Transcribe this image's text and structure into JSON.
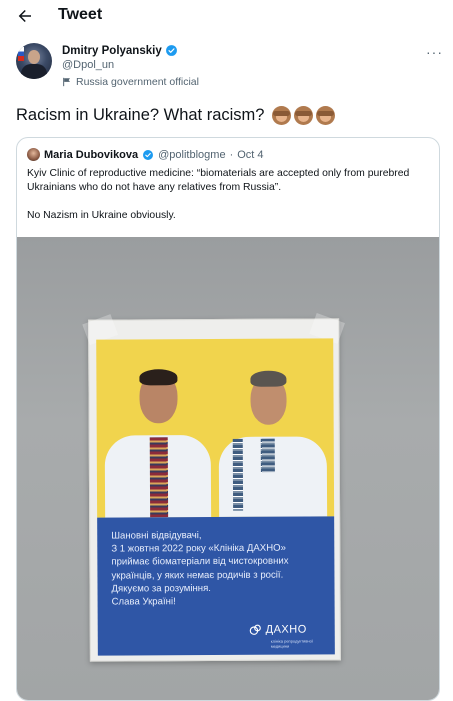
{
  "header": {
    "title": "Tweet"
  },
  "author": {
    "display_name": "Dmitry Polyanskiy",
    "handle": "@Dpol_un",
    "label": "Russia government official"
  },
  "tweet": {
    "text": "Racism in Ukraine? What racism?",
    "emoji": [
      "see-no-evil-monkey",
      "hear-no-evil-monkey",
      "speak-no-evil-monkey"
    ]
  },
  "quoted": {
    "display_name": "Maria Dubovikova",
    "handle": "@politblogme",
    "separator": "·",
    "date": "Oct 4",
    "paragraphs": [
      "Kyiv Clinic of reproductive medicine: “biomaterials are accepted only from purebred Ukrainians who do not have any relatives from Russia”.",
      "No Nazism in Ukraine obviously."
    ]
  },
  "poster": {
    "lines": [
      "Шановні відвідувачі,",
      "З 1 жовтня 2022 року «Клініка ДАХНО»",
      "приймає біоматеріали від чистокровних",
      "українців, у яких немає родичів з росії.",
      "Дякуємо за розуміння.",
      "Слава Україні!"
    ],
    "logo_text": "ДАХНО",
    "logo_subtext": "клініка репродуктивної медицини"
  },
  "colors": {
    "verified_blue": "#1d9bf0",
    "poster_yellow": "#f1d44d",
    "poster_blue": "#2f56a6",
    "secondary_text": "#536471"
  }
}
